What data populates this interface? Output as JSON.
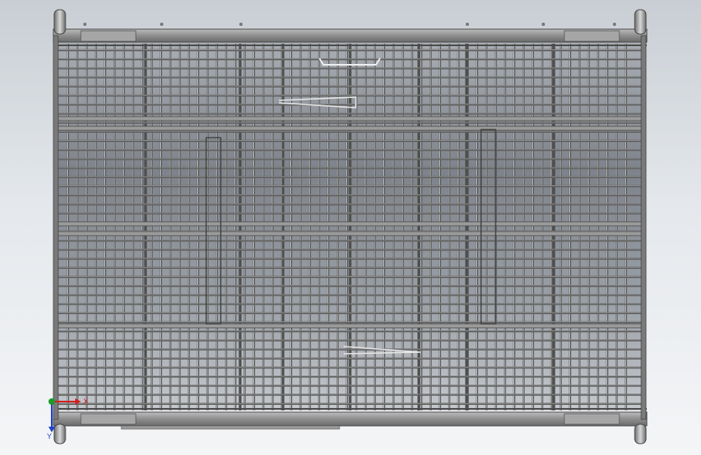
{
  "viewport": {
    "background_top": "#c9ced4",
    "background_bottom": "#f4f5f7"
  },
  "model": {
    "subject": "wire-mesh-cage-top-view",
    "frame_color": "#6f6f6f",
    "bar_color": "#8c8c8c",
    "bar_highlight": "#cfcfcf",
    "panel_color": "#9a9a9a",
    "interior_shadow": "#5b5f66",
    "interior_light": "#b9bec5"
  },
  "triad": {
    "x_label": "X",
    "y_label": "Y",
    "x_color": "#d42020",
    "y_color": "#1f3fd0",
    "origin_color": "#1c9a2a"
  }
}
